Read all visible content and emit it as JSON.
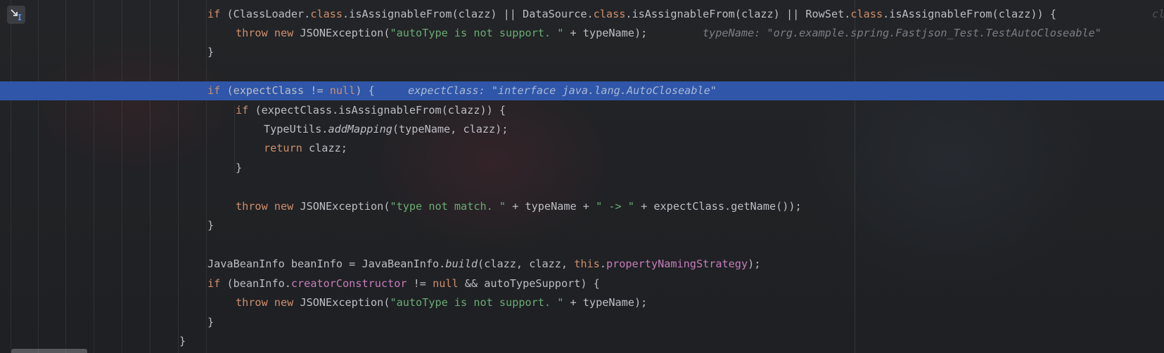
{
  "editor": {
    "colors": {
      "keyword": "#cf8e6d",
      "string": "#6aab73",
      "field": "#c77dbb",
      "text": "#bcbec4",
      "highlight": "#2f56a8",
      "hint": "#7a7e85"
    },
    "gutter_button_icon": "step-into-icon",
    "lines": {
      "l1": {
        "a": "if",
        "b": " (ClassLoader.",
        "c": "class",
        "d": ".isAssignableFrom(clazz) || DataSource.",
        "e": "class",
        "f": ".isAssignableFrom(clazz) || RowSet.",
        "g": "class",
        "h": ".isAssignableFrom(clazz)) {",
        "hint": "cl"
      },
      "l2": {
        "a": "throw",
        "b": " ",
        "c": "new",
        "d": " JSONException(",
        "e": "\"autoType is not support. \"",
        "f": " + typeName);",
        "hint": "typeName: \"org.example.spring.Fastjson_Test.TestAutoCloseable\""
      },
      "l3": {
        "a": "}"
      },
      "l5": {
        "a": "if",
        "b": " (expectClass != ",
        "c": "null",
        "d": ") {",
        "hint": "expectClass: \"interface java.lang.AutoCloseable\""
      },
      "l6": {
        "a": "if",
        "b": " (expectClass.isAssignableFrom(clazz)) {"
      },
      "l7": {
        "a": "TypeUtils.",
        "b": "addMapping",
        "c": "(typeName, clazz);"
      },
      "l8": {
        "a": "return",
        "b": " clazz;"
      },
      "l9": {
        "a": "}"
      },
      "l11": {
        "a": "throw",
        "b": " ",
        "c": "new",
        "d": " JSONException(",
        "e": "\"type not match. \"",
        "f": " + typeName + ",
        "g": "\" -> \"",
        "h": " + expectClass.getName());"
      },
      "l12": {
        "a": "}"
      },
      "l14": {
        "a": "JavaBeanInfo beanInfo = JavaBeanInfo.",
        "b": "build",
        "c": "(clazz, clazz, ",
        "d": "this",
        "e": ".",
        "f": "propertyNamingStrategy",
        "g": ");"
      },
      "l15": {
        "a": "if",
        "b": " (beanInfo.",
        "c": "creatorConstructor",
        "d": " != ",
        "e": "null",
        "f": " && autoTypeSupport) {"
      },
      "l16": {
        "a": "throw",
        "b": " ",
        "c": "new",
        "d": " JSONException(",
        "e": "\"autoType is not support. \"",
        "f": " + typeName);"
      },
      "l17": {
        "a": "}"
      },
      "l18": {
        "a": "}"
      }
    }
  }
}
